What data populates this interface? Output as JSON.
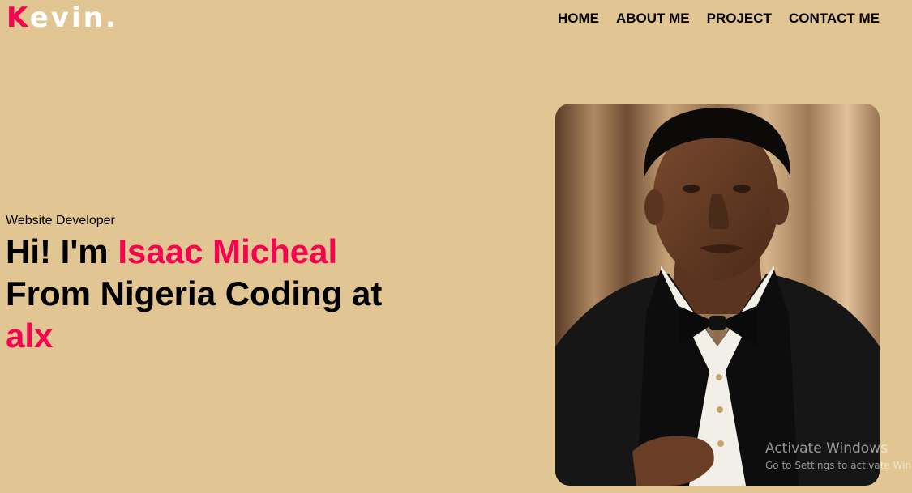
{
  "header": {
    "logo": {
      "first": "K",
      "rest": "evin."
    },
    "nav": [
      {
        "label": "HOME"
      },
      {
        "label": "ABOUT ME"
      },
      {
        "label": "PROJECT"
      },
      {
        "label": "CONTACT ME"
      }
    ]
  },
  "hero": {
    "subtitle": "Website Developer",
    "greeting": "Hi! I'm ",
    "name": "Isaac Micheal",
    "line2": "From Nigeria Coding at",
    "org": "alx"
  },
  "colors": {
    "background": "#e1c593",
    "accent": "#f5054f",
    "text": "#000000"
  },
  "watermark": {
    "title": "Activate Windows",
    "subtitle": "Go to Settings to activate Windows."
  }
}
